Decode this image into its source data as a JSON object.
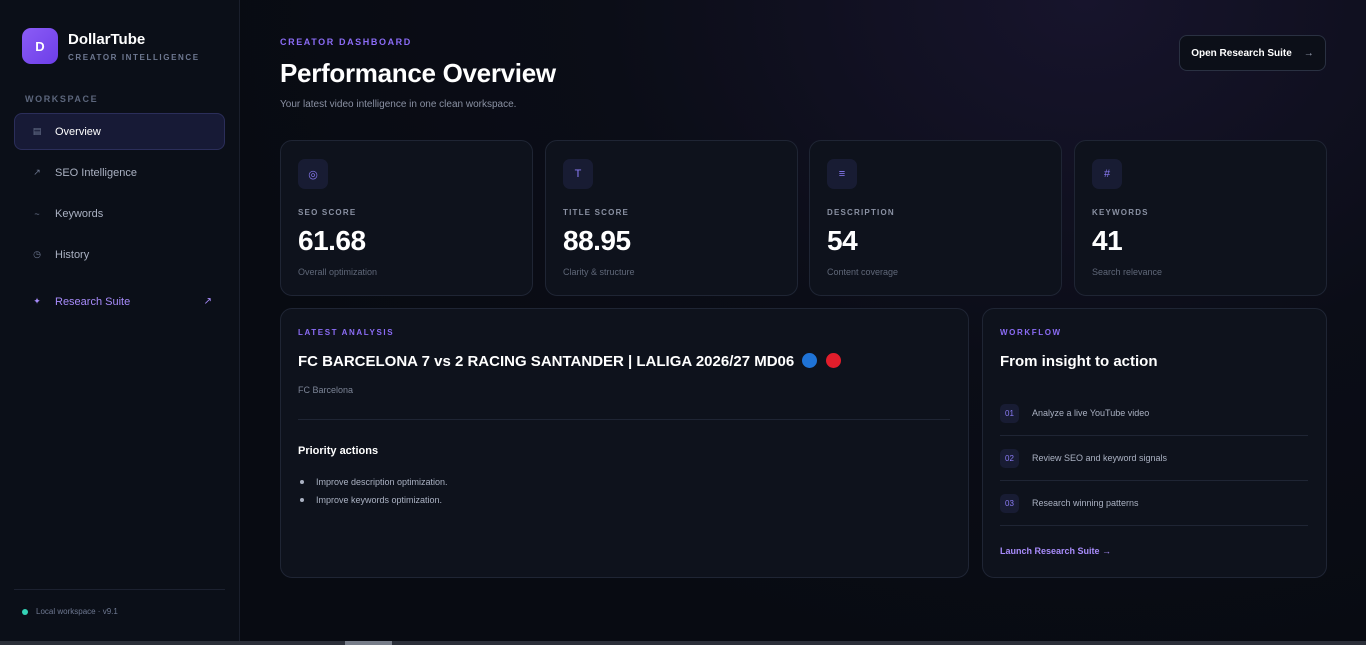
{
  "brand": {
    "logo_letter": "D",
    "name": "DollarTube",
    "subtitle": "CREATOR INTELLIGENCE"
  },
  "sidebar": {
    "section_label": "WORKSPACE",
    "items": [
      {
        "label": "Overview",
        "icon": "grid-icon",
        "glyph": "▤",
        "active": true
      },
      {
        "label": "SEO Intelligence",
        "icon": "trend-icon",
        "glyph": "↗"
      },
      {
        "label": "Keywords",
        "icon": "tilde-icon",
        "glyph": "~"
      },
      {
        "label": "History",
        "icon": "clock-icon",
        "glyph": "◷"
      }
    ],
    "research": {
      "label": "Research Suite",
      "icon": "sparkle-icon",
      "glyph": "✦",
      "ext_glyph": "↗"
    },
    "status": "Local workspace · v9.1"
  },
  "header": {
    "eyebrow": "CREATOR DASHBOARD",
    "title": "Performance Overview",
    "subtitle": "Your latest video intelligence in one clean workspace.",
    "button_label": "Open Research Suite",
    "button_arrow": "→"
  },
  "metrics": [
    {
      "glyph": "◎",
      "icon": "target-icon",
      "label": "SEO SCORE",
      "value": "61.68",
      "note": "Overall optimization"
    },
    {
      "glyph": "T",
      "icon": "text-icon",
      "label": "TITLE SCORE",
      "value": "88.95",
      "note": "Clarity & structure"
    },
    {
      "glyph": "≡",
      "icon": "lines-icon",
      "label": "DESCRIPTION",
      "value": "54",
      "note": "Content coverage"
    },
    {
      "glyph": "#",
      "icon": "hash-icon",
      "label": "KEYWORDS",
      "value": "41",
      "note": "Search relevance"
    }
  ],
  "analysis": {
    "eyebrow": "LATEST ANALYSIS",
    "video_title": "FC BARCELONA 7 vs 2 RACING SANTANDER | LALIGA 2026/27 MD06",
    "flag_colors": [
      "#1f73d6",
      "#e11d2b"
    ],
    "channel": "FC Barcelona",
    "priority_title": "Priority actions",
    "actions": [
      "Improve description optimization.",
      "Improve keywords optimization."
    ]
  },
  "workflow": {
    "eyebrow": "WORKFLOW",
    "title": "From insight to action",
    "steps": [
      {
        "num": "01",
        "text": "Analyze a live YouTube video"
      },
      {
        "num": "02",
        "text": "Review SEO and keyword signals"
      },
      {
        "num": "03",
        "text": "Research winning patterns"
      }
    ],
    "link": "Launch Research Suite →"
  }
}
